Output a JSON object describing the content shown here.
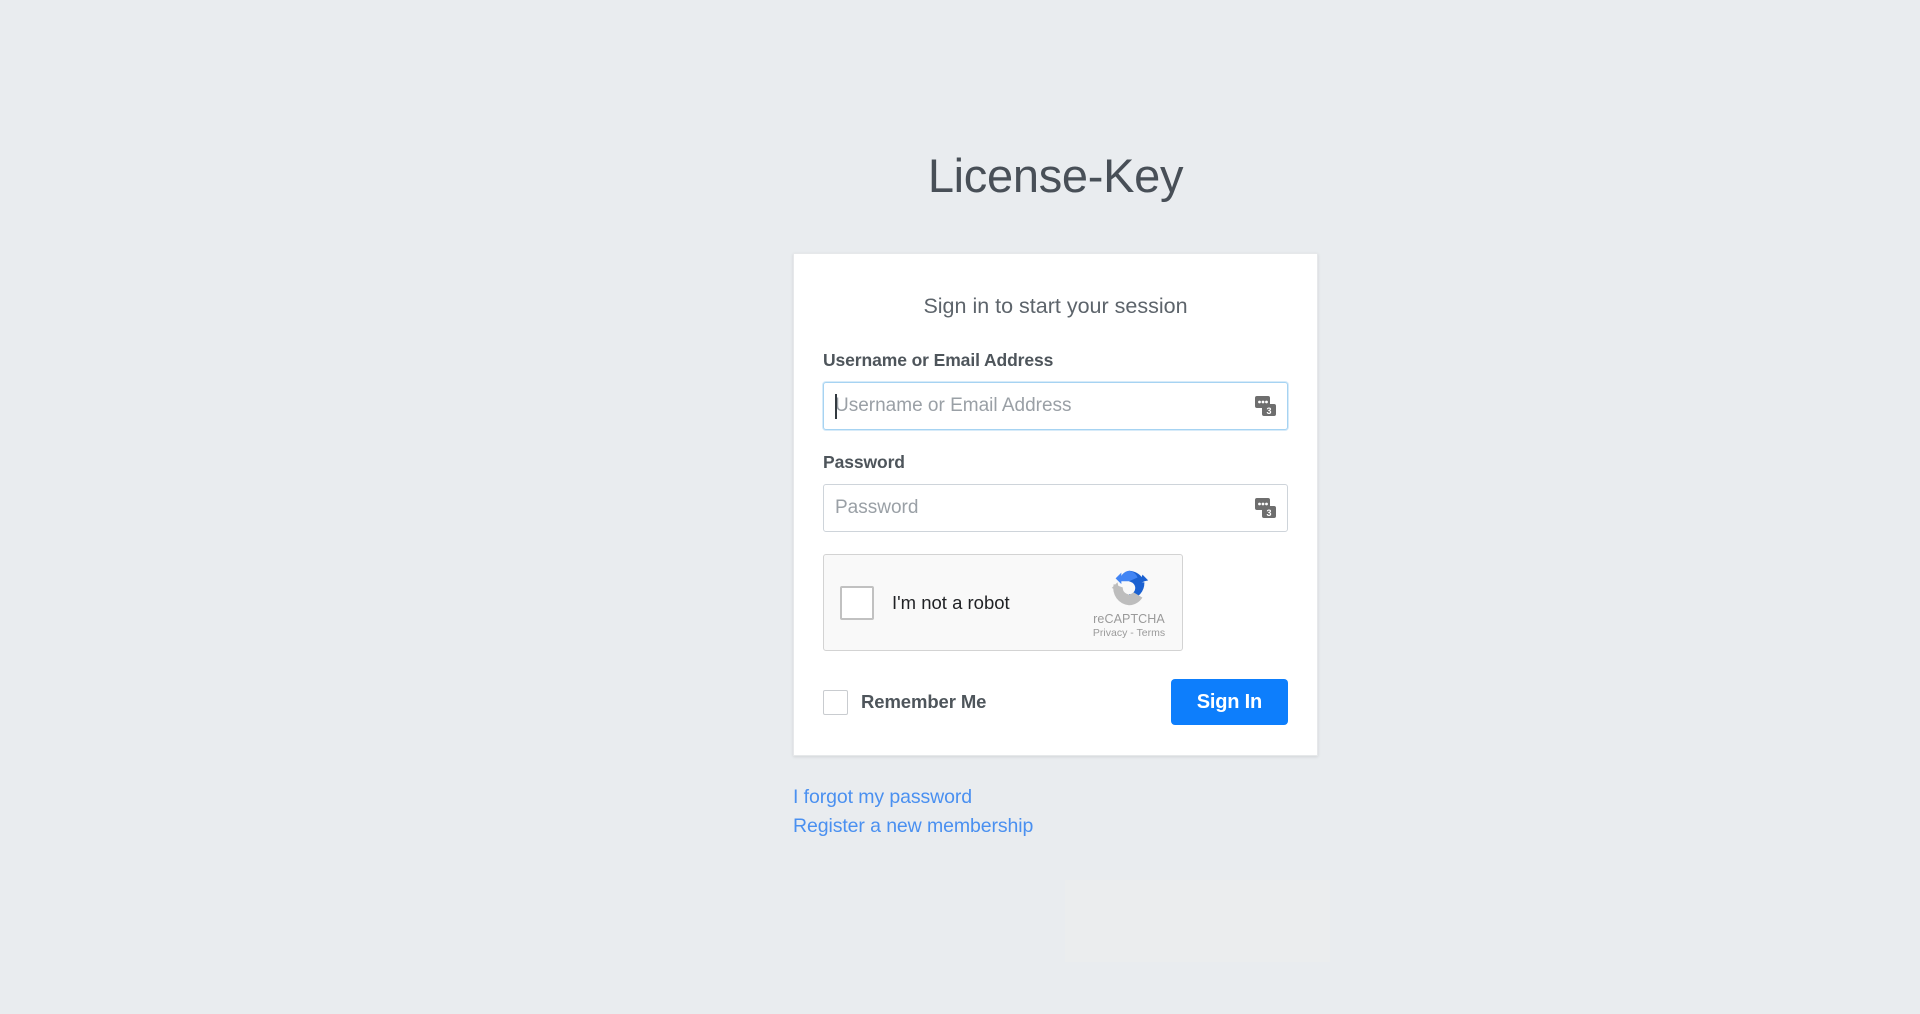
{
  "brand": {
    "title": "License-Key"
  },
  "card": {
    "message": "Sign in to start your session",
    "username": {
      "label": "Username or Email Address",
      "placeholder": "Username or Email Address",
      "value": "",
      "icon": "password-manager-icon",
      "focused": true
    },
    "password": {
      "label": "Password",
      "placeholder": "Password",
      "value": "",
      "icon": "password-manager-icon",
      "focused": false
    },
    "recaptcha": {
      "checkbox_label": "I'm not a robot",
      "brand_name": "reCAPTCHA",
      "privacy_label": "Privacy",
      "separator": "-",
      "terms_label": "Terms",
      "checked": false,
      "logo_colors": {
        "light_blue": "#4285f4",
        "dark_blue": "#1b61d1",
        "grey": "#bdbdbd"
      }
    },
    "remember": {
      "label": "Remember Me",
      "checked": false
    },
    "submit": {
      "label": "Sign In",
      "color": "#0d7efc"
    }
  },
  "links": {
    "forgot_password": "I forgot my password",
    "register": "Register a new membership",
    "color": "#4a90f0"
  },
  "theme": {
    "background": "#e9ecef",
    "card_background": "#ffffff",
    "heading_color": "#484f57",
    "label_color": "#4e555b"
  }
}
